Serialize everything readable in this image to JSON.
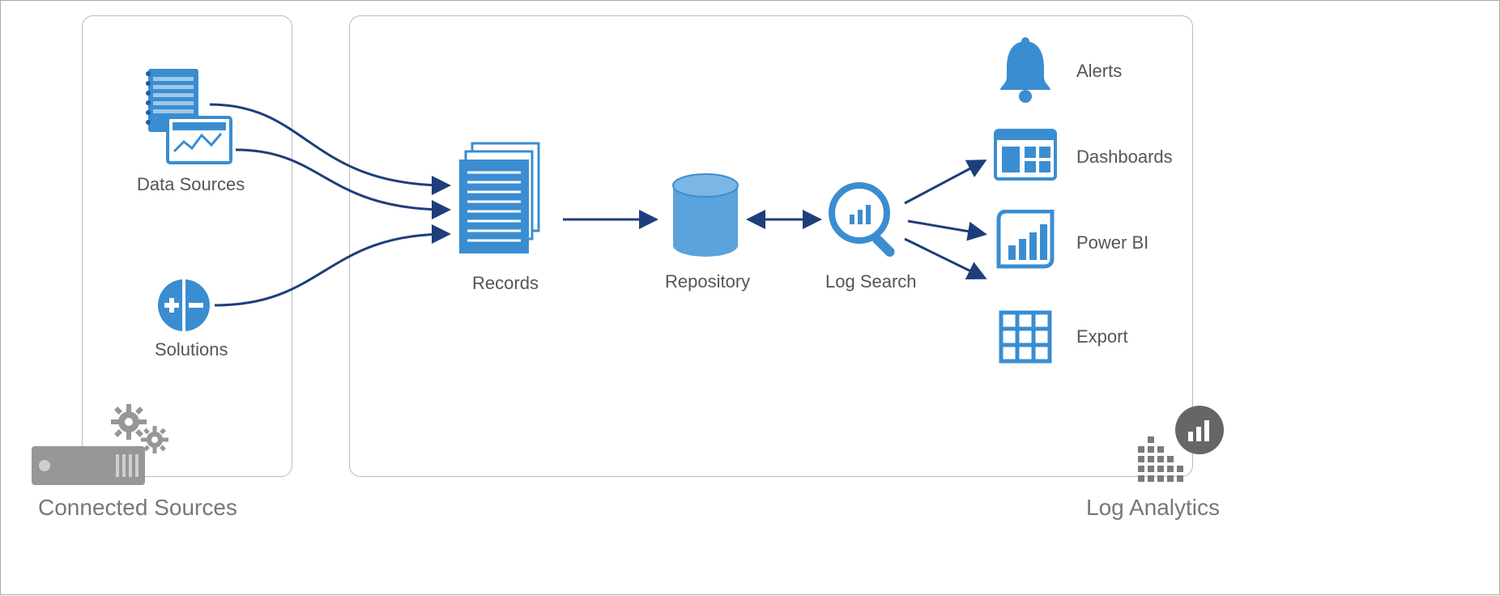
{
  "diagram": {
    "left_group_label": "Connected Sources",
    "right_group_label": "Log Analytics",
    "nodes": {
      "data_sources": "Data Sources",
      "solutions": "Solutions",
      "records": "Records",
      "repository": "Repository",
      "log_search": "Log Search",
      "alerts": "Alerts",
      "dashboards": "Dashboards",
      "power_bi": "Power BI",
      "export": "Export"
    }
  }
}
